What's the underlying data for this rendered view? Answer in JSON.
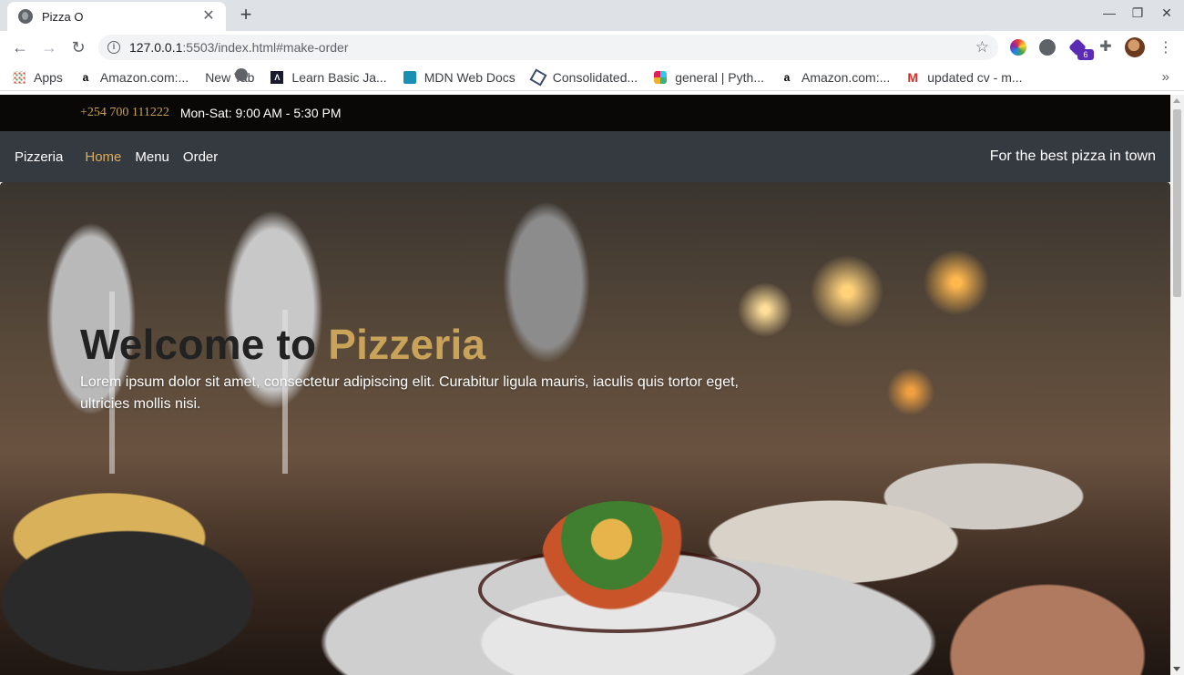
{
  "browser": {
    "tab_title": "Pizza O",
    "url_host": "127.0.0.1",
    "url_rest": ":5503/index.html#make-order",
    "ext_badge": "6",
    "bookmarks": [
      {
        "label": "Apps",
        "icon": "apps-grid-icon"
      },
      {
        "label": "Amazon.com:...",
        "icon": "amazon-icon"
      },
      {
        "label": "New Tab",
        "icon": "globe-icon"
      },
      {
        "label": "Learn Basic Ja...",
        "icon": "learn-icon"
      },
      {
        "label": "MDN Web Docs",
        "icon": "mdn-icon"
      },
      {
        "label": "Consolidated...",
        "icon": "consolidated-icon"
      },
      {
        "label": "general | Pyth...",
        "icon": "slack-icon"
      },
      {
        "label": "Amazon.com:...",
        "icon": "amazon-icon"
      },
      {
        "label": "updated cv - m...",
        "icon": "gmail-icon"
      }
    ]
  },
  "page": {
    "topbar": {
      "phone": "+254 700 111222",
      "hours": "Mon-Sat: 9:00 AM - 5:30 PM"
    },
    "nav": {
      "brand": "Pizzeria",
      "links": [
        {
          "label": "Home",
          "active": true
        },
        {
          "label": "Menu",
          "active": false
        },
        {
          "label": "Order",
          "active": false
        }
      ],
      "tagline": "For the best pizza in town"
    },
    "hero": {
      "title_prefix": "Welcome to ",
      "title_accent": "Pizzeria",
      "subtitle": "Lorem ipsum dolor sit amet, consectetur adipiscing elit. Curabitur ligula mauris, iaculis quis tortor eget, ultricies mollis nisi."
    },
    "colors": {
      "accent": "#c9a35a",
      "topbar": "#0a0806",
      "navbar": "#343a40"
    }
  }
}
